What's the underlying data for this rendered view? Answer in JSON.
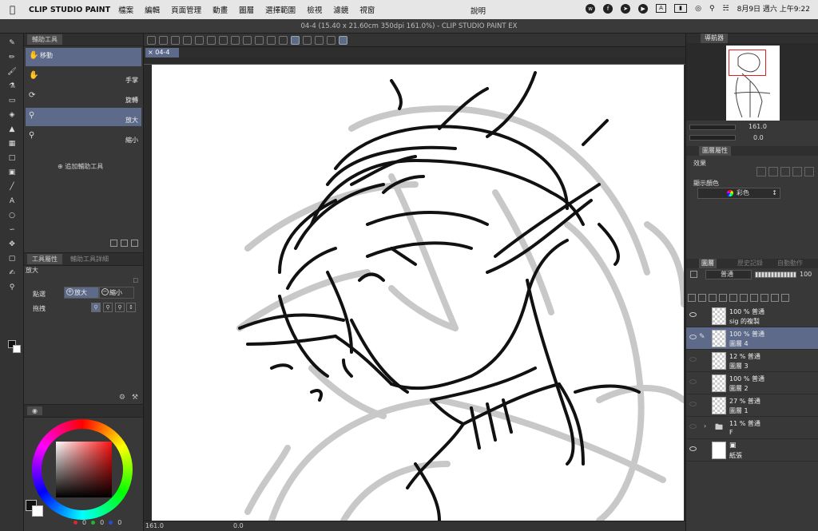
{
  "menubar": {
    "app_name": "CLIP STUDIO PAINT",
    "items": [
      "檔案",
      "編輯",
      "頁面管理",
      "動畫",
      "圖層",
      "選擇範圍",
      "檢視",
      "濾鏡",
      "視窗"
    ],
    "help": "說明",
    "date": "8月9日 週六 上午9:22"
  },
  "window_title": "04-4 (15.40 x 21.60cm 350dpi 161.0%)  - CLIP STUDIO PAINT EX",
  "document_tab": "04-4",
  "sub_tool_panel": {
    "tab_label": "輔助工具",
    "tools": [
      {
        "label": "移動"
      },
      {
        "label": "手掌"
      },
      {
        "label": "旋轉"
      },
      {
        "label": "放大"
      },
      {
        "label": "縮小"
      }
    ],
    "add_label": "追加輔助工具"
  },
  "tool_property": {
    "tab_label": "工具屬性",
    "tab_label_2": "輔助工具詳細",
    "title": "放大",
    "click_label": "點選",
    "click_zoom_in": "放大",
    "click_zoom_out": "縮小",
    "drag_label": "拖拽"
  },
  "color_panel": {
    "rgb_values": [
      "0",
      "0",
      "0"
    ],
    "colors": {
      "red": "#d82a2a",
      "green": "#2ab02a",
      "blue": "#2a4ad8"
    }
  },
  "navigator": {
    "tab_label": "導航器",
    "zoom_value": "161.0",
    "rotate_value": "0.0"
  },
  "layer_property": {
    "tab_label": "圖層屬性",
    "effect_label": "效果",
    "display_color_label": "顯示顏色",
    "display_color_value": "彩色"
  },
  "layer_panel": {
    "tabs": [
      "圖層",
      "歷史記錄",
      "自動動作"
    ],
    "blend_mode": "普通",
    "opacity": "100",
    "layers": [
      {
        "opacity": "100 %  普通",
        "name": "sig 的複製",
        "visible": true,
        "selected": false
      },
      {
        "opacity": "100 %  普通",
        "name": "圖層 4",
        "visible": true,
        "selected": true
      },
      {
        "opacity": "12 %  普通",
        "name": "圖層 3",
        "visible": false,
        "selected": false
      },
      {
        "opacity": "100 %  普通",
        "name": "圖層 2",
        "visible": false,
        "selected": false
      },
      {
        "opacity": "27 %  普通",
        "name": "圖層 1",
        "visible": false,
        "selected": false
      },
      {
        "opacity": "11 %  普通",
        "name": "F",
        "visible": false,
        "selected": false,
        "folder": true
      },
      {
        "opacity": "",
        "name": "紙張",
        "visible": true,
        "selected": false,
        "paper": true
      }
    ]
  },
  "bottom_bar": {
    "zoom": "161.0",
    "rotate": "0.0"
  }
}
